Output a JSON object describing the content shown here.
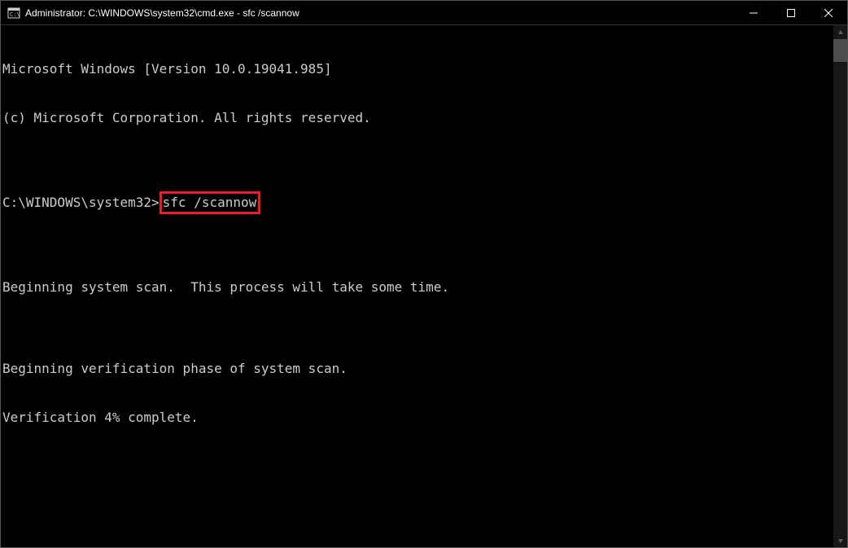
{
  "window": {
    "title": "Administrator: C:\\WINDOWS\\system32\\cmd.exe - sfc  /scannow"
  },
  "console": {
    "line1": "Microsoft Windows [Version 10.0.19041.985]",
    "line2": "(c) Microsoft Corporation. All rights reserved.",
    "blank1": "",
    "prompt_prefix": "C:\\WINDOWS\\system32>",
    "command": "sfc /scannow",
    "blank2": "",
    "line4": "Beginning system scan.  This process will take some time.",
    "blank3": "",
    "line5": "Beginning verification phase of system scan.",
    "line6": "Verification 4% complete."
  }
}
